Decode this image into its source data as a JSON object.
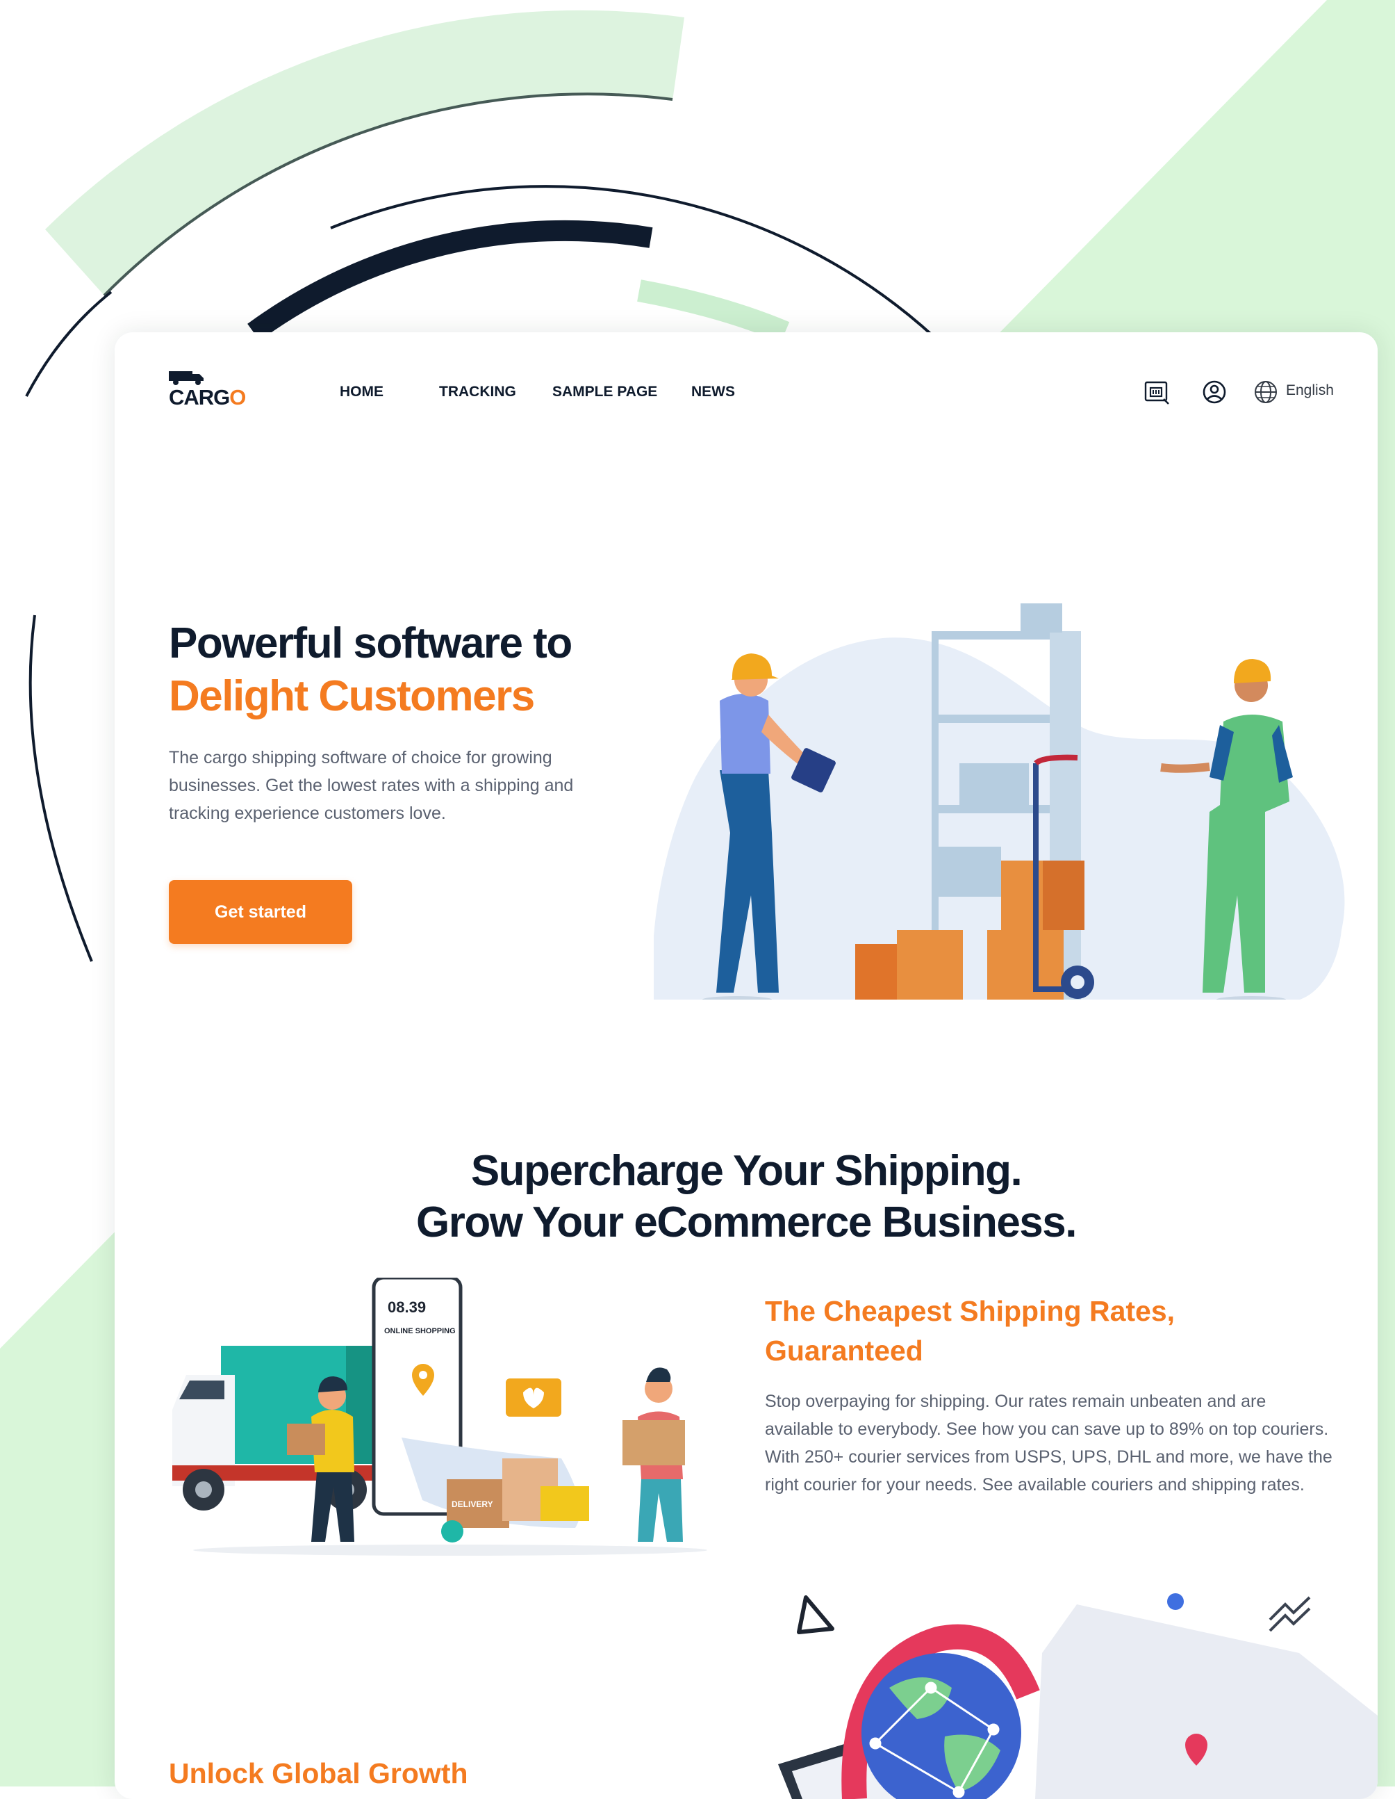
{
  "brand": {
    "name_prefix": "CARG",
    "name_suffix": "O",
    "accent": "#f47b20",
    "dark": "#0f1b2d"
  },
  "nav": {
    "items": [
      "HOME",
      "TRACKING",
      "SAMPLE PAGE",
      "NEWS"
    ]
  },
  "header_icons": [
    "package-scan-icon",
    "user-circle-icon",
    "globe-icon"
  ],
  "language": "English",
  "hero": {
    "title_line1": "Powerful software to",
    "title_line2": "Delight Customers",
    "description": "The cargo shipping software of choice for growing businesses. Get the lowest rates with a shipping and tracking experience customers love.",
    "cta": "Get started"
  },
  "section2": {
    "title_line1": "Supercharge Your Shipping.",
    "title_line2": "Grow Your eCommerce Business."
  },
  "feature": {
    "title": "The Cheapest Shipping Rates, Guaranteed",
    "description": "Stop overpaying for shipping. Our rates remain unbeaten and are available to everybody. See how you can save up to 89% on top couriers. With 250+ courier services from USPS, UPS, DHL and more, we have the right courier for your needs. See available couriers and shipping rates."
  },
  "phone_mock": {
    "time": "08.39",
    "caption": "ONLINE SHOPPING"
  },
  "parcel_label": "DELIVERY",
  "section3": {
    "title": "Unlock Global Growth"
  }
}
